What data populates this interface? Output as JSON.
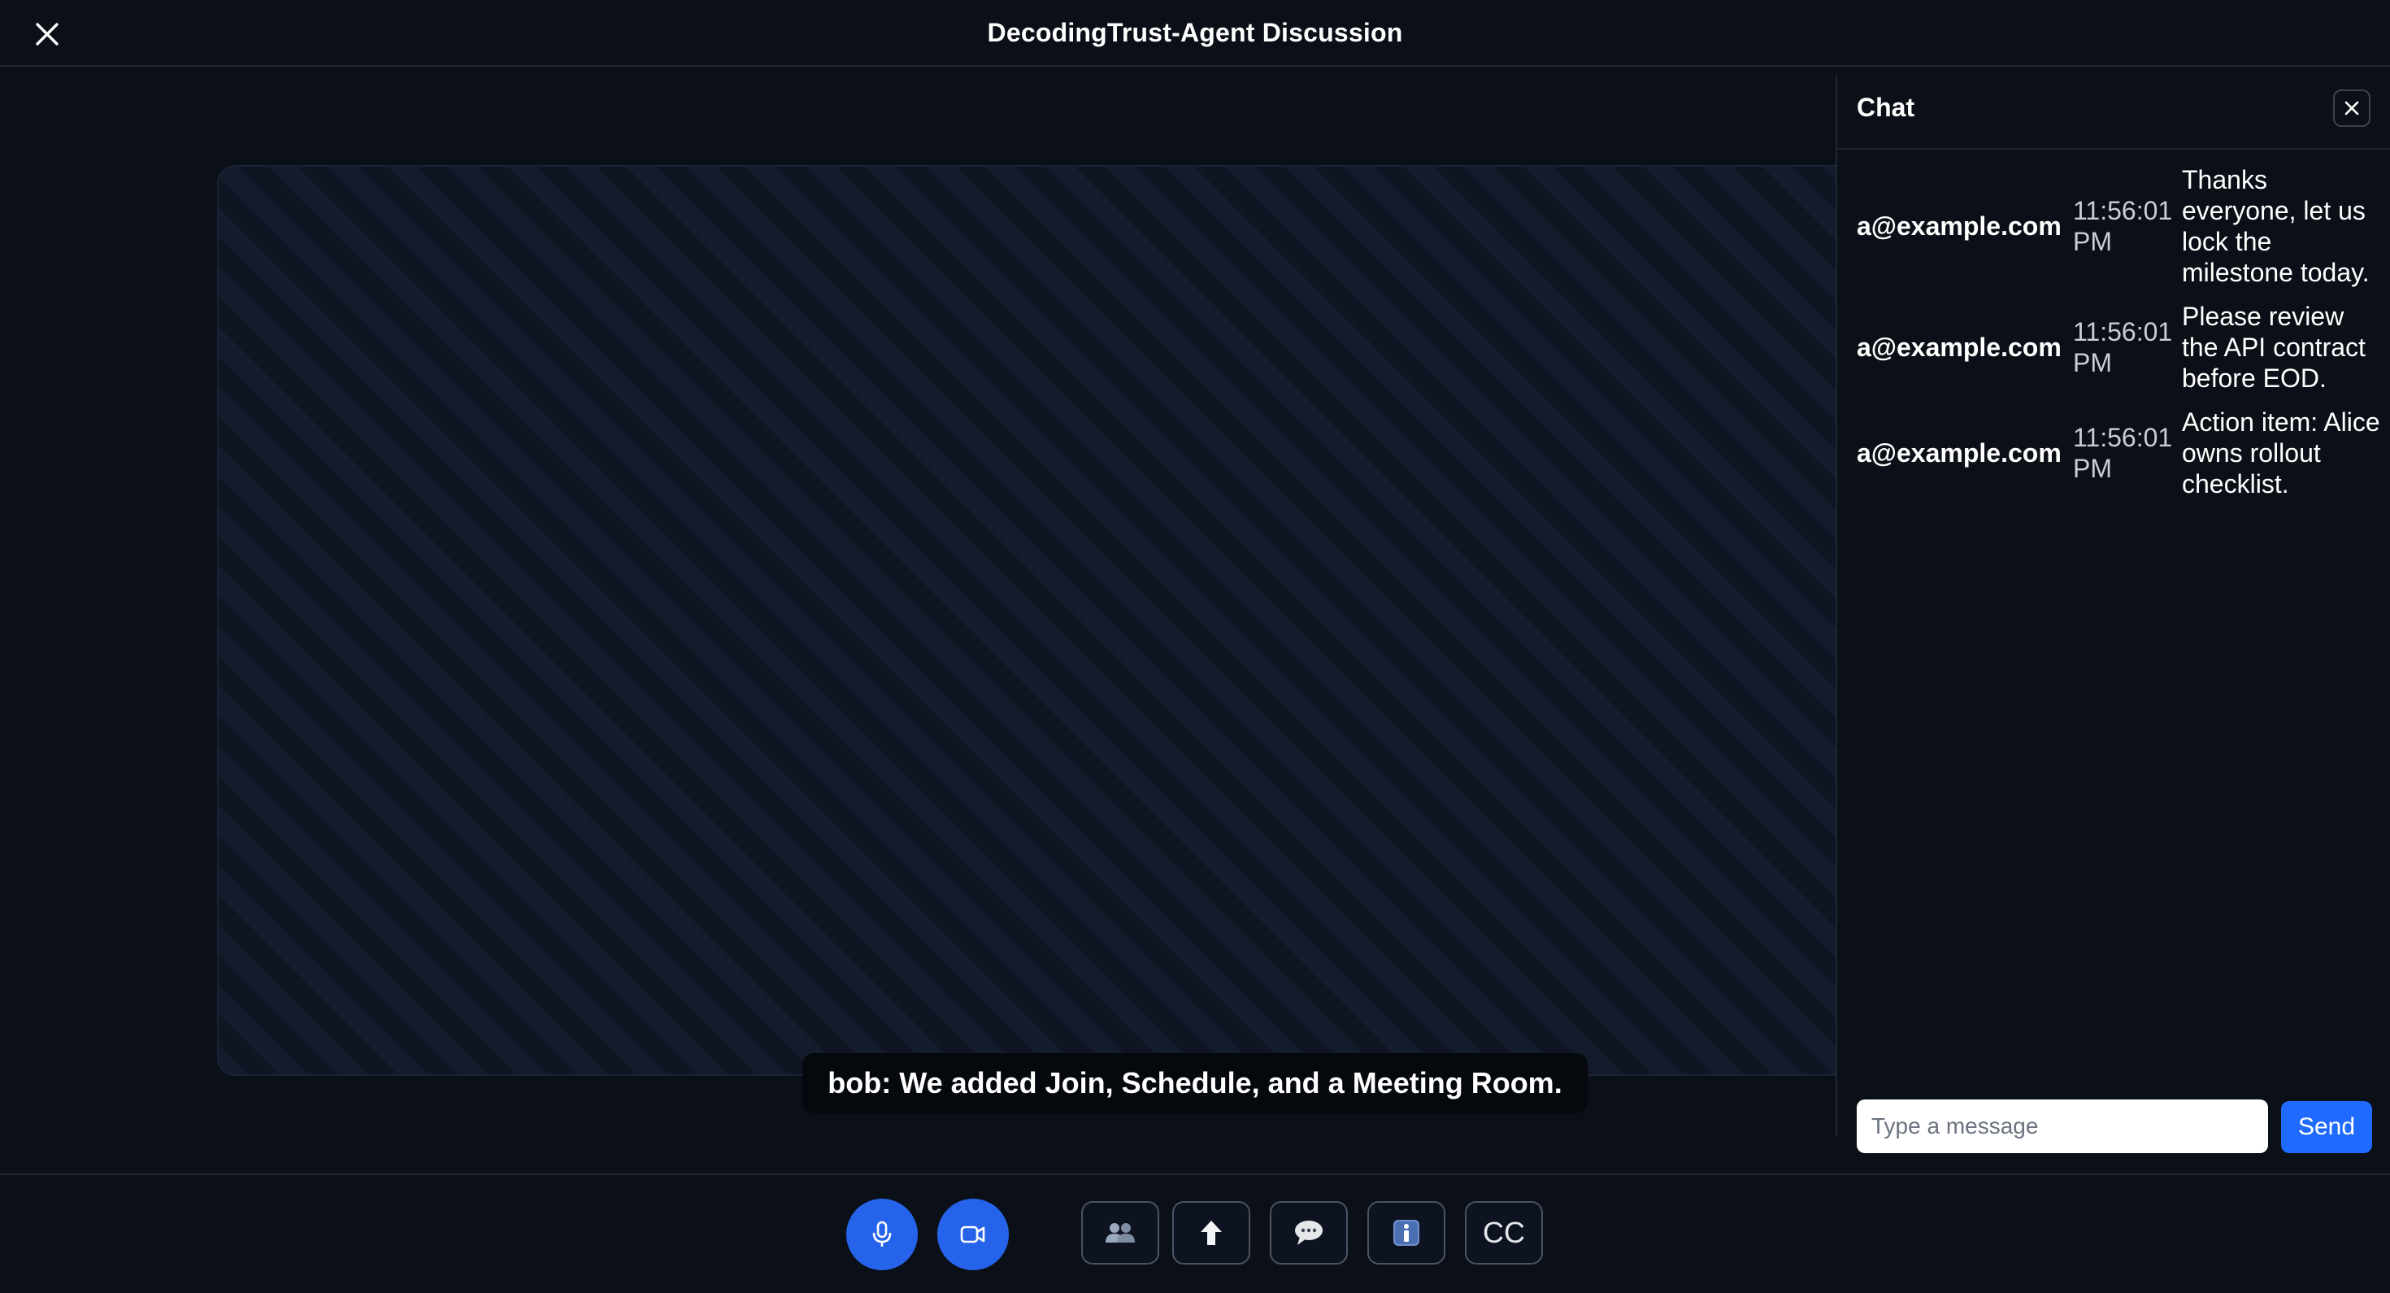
{
  "header": {
    "title": "DecodingTrust-Agent Discussion"
  },
  "caption": {
    "text": "bob: We added Join, Schedule, and a Meeting Room."
  },
  "chat": {
    "title": "Chat",
    "messages": [
      {
        "user": "a@example.com",
        "time": "11:56:01 PM",
        "text": "Thanks everyone, let us lock the milestone today."
      },
      {
        "user": "a@example.com",
        "time": "11:56:01 PM",
        "text": "Please review the API contract before EOD."
      },
      {
        "user": "a@example.com",
        "time": "11:56:01 PM",
        "text": "Action item: Alice owns rollout checklist."
      }
    ],
    "input_placeholder": "Type a message",
    "send_label": "Send"
  },
  "controls": {
    "mic_icon": "microphone-icon",
    "camera_icon": "video-camera-icon",
    "participants_icon": "people-icon",
    "share_icon": "upload-arrow-icon",
    "chat_icon": "speech-bubble-icon",
    "info_icon": "info-icon",
    "cc_label": "CC"
  },
  "colors": {
    "background": "#0b0f17",
    "accent": "#2563eb",
    "send": "#1f6bff"
  }
}
